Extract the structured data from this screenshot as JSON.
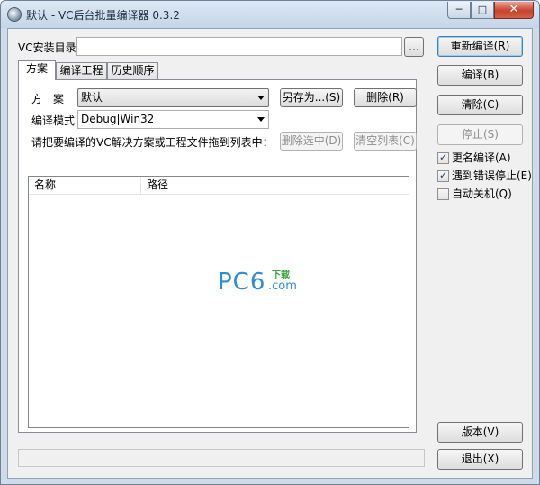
{
  "window": {
    "title": "默认 - VC后台批量编译器 0.3.2",
    "caption": {
      "minimize": "─",
      "maximize": "□",
      "close": "✕"
    }
  },
  "install_dir": {
    "label": "VC安装目录",
    "value": "",
    "browse_label": "..."
  },
  "tabs": [
    {
      "label": "方案",
      "active": true
    },
    {
      "label": "编译工程",
      "active": false
    },
    {
      "label": "历史顺序",
      "active": false
    }
  ],
  "scheme": {
    "label": "方　案",
    "value": "默认",
    "save_as_label": "另存为...(S)",
    "delete_label": "删除(R)"
  },
  "build_mode": {
    "label": "编译模式",
    "value": "Debug|Win32"
  },
  "drop_hint": "请把要编译的VC解决方案或工程文件拖到列表中：",
  "list_actions": {
    "remove_selected_label": "删除选中(D)",
    "clear_list_label": "清空列表(C)"
  },
  "list": {
    "columns": [
      "名称",
      "路径"
    ],
    "rows": []
  },
  "watermark": {
    "brand": "PC6",
    "suffix": ".com",
    "tag": "下载"
  },
  "side_buttons": {
    "rebuild": "重新编译(R)",
    "build": "编译(B)",
    "clean": "清除(C)",
    "stop": "停止(S)",
    "version": "版本(V)",
    "exit": "退出(X)"
  },
  "options": [
    {
      "label": "更名编译(A)",
      "checked": true
    },
    {
      "label": "遇到错误停止(E)",
      "checked": true
    },
    {
      "label": "自动关机(Q)",
      "checked": false
    }
  ],
  "colors": {
    "accent": "#3c7fb1",
    "watermark_blue": "#2a8fd6",
    "watermark_green": "#3aa33a"
  }
}
